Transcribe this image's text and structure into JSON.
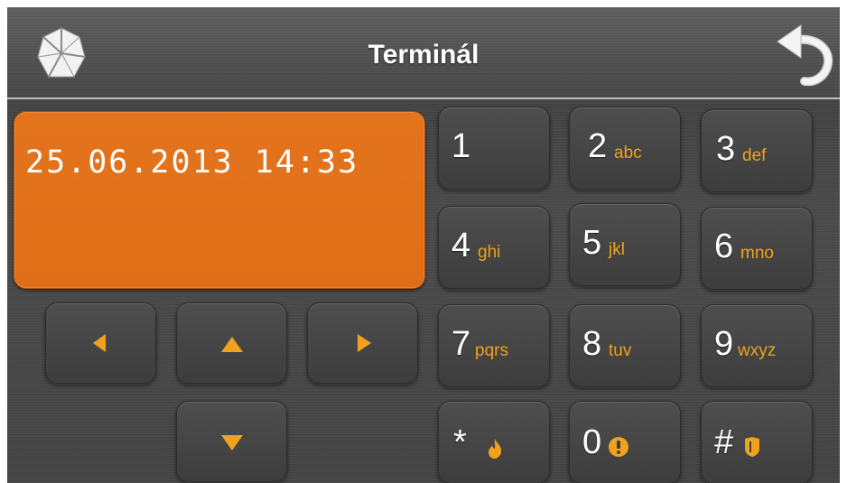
{
  "header": {
    "title": "Terminál",
    "logo_icon": "satel-logo-icon",
    "back_icon": "back-arrow-icon"
  },
  "display": {
    "text": "25.06.2013 14:33"
  },
  "keypad": {
    "keys": [
      {
        "digit": "1",
        "letters": ""
      },
      {
        "digit": "2",
        "letters": "abc"
      },
      {
        "digit": "3",
        "letters": "def"
      },
      {
        "digit": "4",
        "letters": "ghi"
      },
      {
        "digit": "5",
        "letters": "jkl"
      },
      {
        "digit": "6",
        "letters": "mno"
      },
      {
        "digit": "7",
        "letters": "pqrs"
      },
      {
        "digit": "8",
        "letters": "tuv"
      },
      {
        "digit": "9",
        "letters": "wxyz"
      },
      {
        "digit": "*",
        "icon": "fire-icon"
      },
      {
        "digit": "0",
        "icon": "alert-icon"
      },
      {
        "digit": "#",
        "icon": "panic-shield-icon"
      }
    ]
  },
  "navigation": {
    "left_icon": "arrow-left-icon",
    "up_icon": "arrow-up-icon",
    "right_icon": "arrow-right-icon",
    "down_icon": "arrow-down-icon"
  },
  "colors": {
    "display_bg": "#e3741d",
    "accent": "#f0a21c",
    "key_bg": "#454545",
    "background": "#444444"
  }
}
